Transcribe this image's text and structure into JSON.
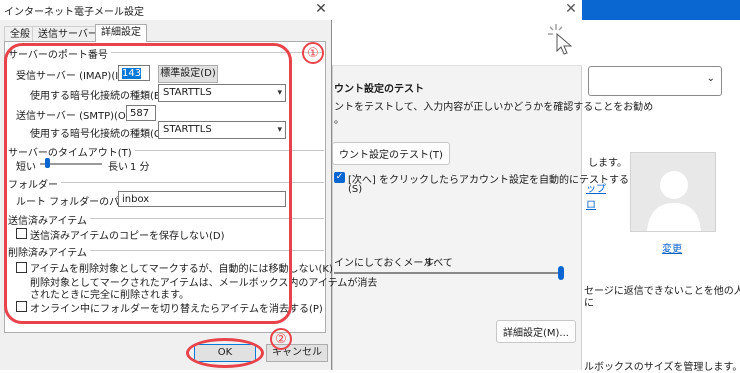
{
  "dialog": {
    "title": "インターネット電子メール設定",
    "close_glyph": "✕",
    "tabs": [
      {
        "label": "全般",
        "active": false
      },
      {
        "label": "送信サーバー",
        "active": false
      },
      {
        "label": "詳細設定",
        "active": true
      }
    ],
    "port_group": "サーバーのポート番号",
    "incoming_label": "受信サーバー (IMAP)(I):",
    "incoming_value": "143",
    "default_button": "標準設定(D)",
    "incoming_enc_label": "使用する暗号化接続の種類(E):",
    "incoming_enc_value": "STARTTLS",
    "outgoing_label": "送信サーバー (SMTP)(O):",
    "outgoing_value": "587",
    "outgoing_enc_label": "使用する暗号化接続の種類(C):",
    "outgoing_enc_value": "STARTTLS",
    "timeout_group": "サーバーのタイムアウト(T)",
    "timeout_short": "短い",
    "timeout_long": "長い",
    "timeout_value": "1 分",
    "timeout_level": 0.12,
    "folder_group": "フォルダー",
    "root_label": "ルート フォルダーのパス(F):",
    "root_value": "inbox",
    "sent_group": "送信済みアイテム",
    "sent_check": "送信済みアイテムのコピーを保存しない(D)",
    "sent_checked": false,
    "deleted_group": "削除済みアイテム",
    "mark_check": "アイテムを削除対象としてマークするが、自動的には移動しない(K)",
    "mark_note_1": "削除対象としてマークされたアイテムは、メールボックス内のアイテムが消去",
    "mark_note_2": "されたときに完全に削除されます。",
    "purge_check": "オンライン中にフォルダーを切り替えたらアイテムを消去する(P)",
    "ok": "OK",
    "cancel": "キャンセル"
  },
  "annotations": {
    "one": "①",
    "two": "②",
    "color": "#e8434a"
  },
  "background": {
    "close_glyph": "✕",
    "test_heading": "ウント設定のテスト",
    "test_desc_1": "ントをテストして、入力内容が正しいかどうかを確認することをお勧め",
    "test_desc_2": "。",
    "test_button": "ウント設定のテスト(T)",
    "auto_test_1": "[次へ] をクリックしたらアカウント設定を自動的にテストする",
    "auto_test_2": "(S)",
    "offline_label": "インにしておくメール:",
    "offline_value": "すべて",
    "offline_level": 1.0,
    "advanced_button": "詳細設定(M)...",
    "right_text_1": "します。",
    "right_text_2": "セージに返信できないことを他の人に",
    "right_text_3": "に",
    "right_text_4": "ルボックスのサイズを管理します。",
    "link_1": "ップ",
    "link_2": "ロ",
    "change_link": "変更",
    "accent": "#0a66d1"
  }
}
